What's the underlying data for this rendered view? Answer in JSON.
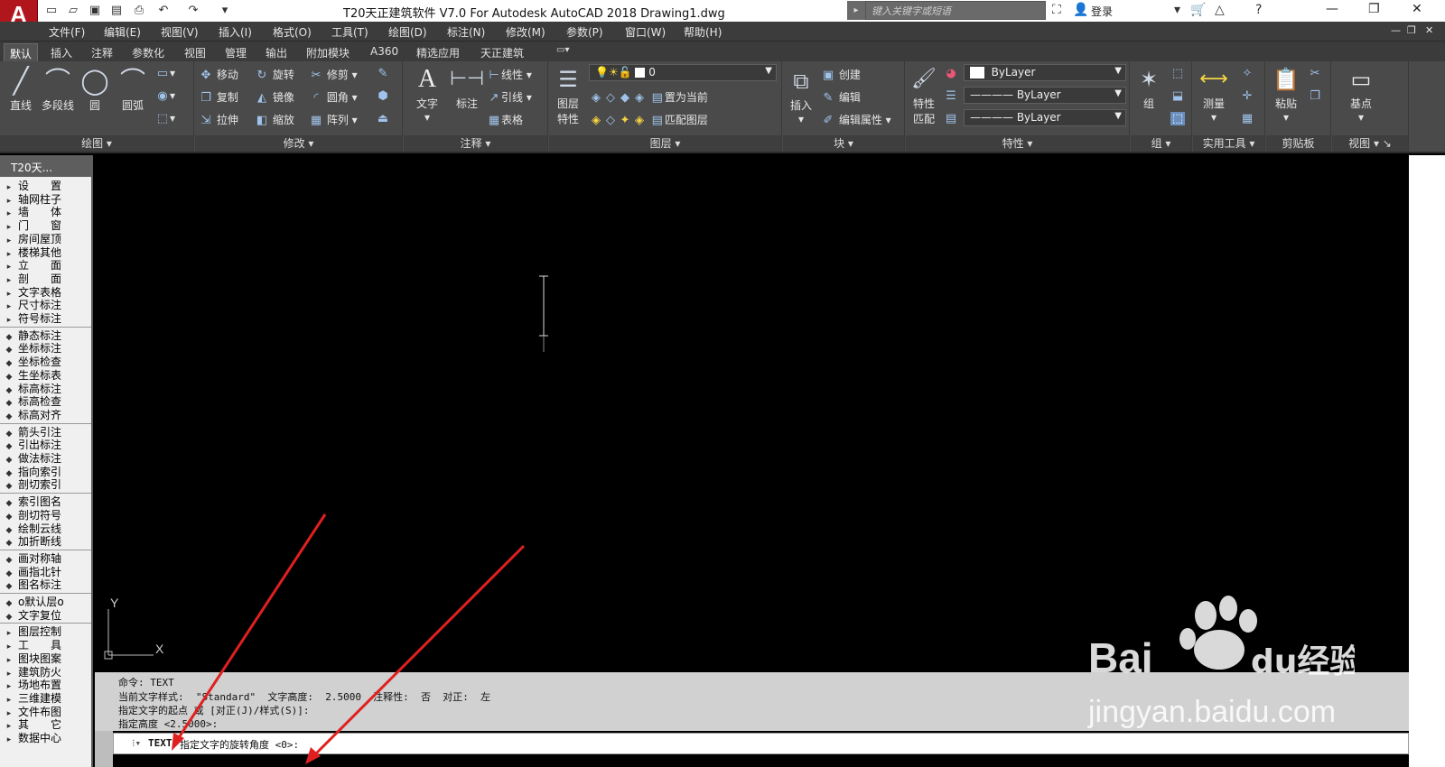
{
  "title_bar": {
    "app_button": "A",
    "title": "T20天正建筑软件 V7.0 For Autodesk AutoCAD 2018    Drawing1.dwg",
    "search_placeholder": "键入关键字或短语",
    "login_label": "登录"
  },
  "menu": [
    "文件(F)",
    "编辑(E)",
    "视图(V)",
    "插入(I)",
    "格式(O)",
    "工具(T)",
    "绘图(D)",
    "标注(N)",
    "修改(M)",
    "参数(P)",
    "窗口(W)",
    "帮助(H)"
  ],
  "tabs": [
    "默认",
    "插入",
    "注释",
    "参数化",
    "视图",
    "管理",
    "输出",
    "附加模块",
    "A360",
    "精选应用",
    "天正建筑"
  ],
  "ribbon": {
    "draw": {
      "label": "绘图",
      "line": "直线",
      "pline": "多段线",
      "circle": "圆",
      "arc": "圆弧"
    },
    "modify": {
      "label": "修改",
      "move": "移动",
      "rotate": "旋转",
      "trim": "修剪",
      "copy": "复制",
      "mirror": "镜像",
      "fillet": "圆角",
      "stretch": "拉伸",
      "scale": "缩放",
      "array": "阵列"
    },
    "annotation": {
      "label": "注释",
      "text": "文字",
      "dim": "标注",
      "linear": "线性",
      "leader": "引线",
      "table": "表格"
    },
    "layers": {
      "label": "图层",
      "props": "图层\n特性",
      "layer_name": "0",
      "set_current": "置为当前",
      "match_layer": "匹配图层"
    },
    "block": {
      "label": "块",
      "insert": "插入",
      "create": "创建",
      "edit": "编辑",
      "edit_attr": "编辑属性"
    },
    "properties": {
      "label": "特性",
      "match": "特性\n匹配",
      "color": "ByLayer",
      "linetype": "ByLayer",
      "lineweight": "ByLayer"
    },
    "groups": {
      "label": "组",
      "group": "组"
    },
    "utilities": {
      "label": "实用工具",
      "measure": "测量"
    },
    "clipboard": {
      "label": "剪贴板",
      "paste": "粘贴"
    },
    "view": {
      "label": "视图",
      "base": "基点"
    }
  },
  "palette": {
    "title": "T20天...",
    "items": [
      "设　　置",
      "轴网柱子",
      "墙　　体",
      "门　　窗",
      "房间屋顶",
      "楼梯其他",
      "立　　面",
      "剖　　面",
      "文字表格",
      "尺寸标注",
      "符号标注",
      "静态标注",
      "坐标标注",
      "坐标检查",
      "生坐标表",
      "标高标注",
      "标高检查",
      "标高对齐",
      "箭头引注",
      "引出标注",
      "做法标注",
      "指向索引",
      "剖切索引",
      "索引图名",
      "剖切符号",
      "绘制云线",
      "加折断线",
      "画对称轴",
      "画指北针",
      "图名标注",
      "o默认层o",
      "文字复位",
      "图层控制",
      "工　　具",
      "图块图案",
      "建筑防火",
      "场地布置",
      "三维建模",
      "文件布图",
      "其　　它",
      "数据中心"
    ]
  },
  "ucs": {
    "x": "X",
    "y": "Y"
  },
  "command": {
    "history": [
      "命令: TEXT",
      "当前文字样式:  \"Standard\"  文字高度:  2.5000  注释性:  否  对正:  左",
      "指定文字的起点 或 [对正(J)/样式(S)]:",
      "指定高度 <2.5000>:"
    ],
    "prompt_cmd": "TEXT",
    "prompt_text": "指定文字的旋转角度 <0>:"
  },
  "watermark": {
    "brand": "Bai",
    "brand2": "du",
    "cn": "经验",
    "url": "jingyan.baidu.com"
  }
}
